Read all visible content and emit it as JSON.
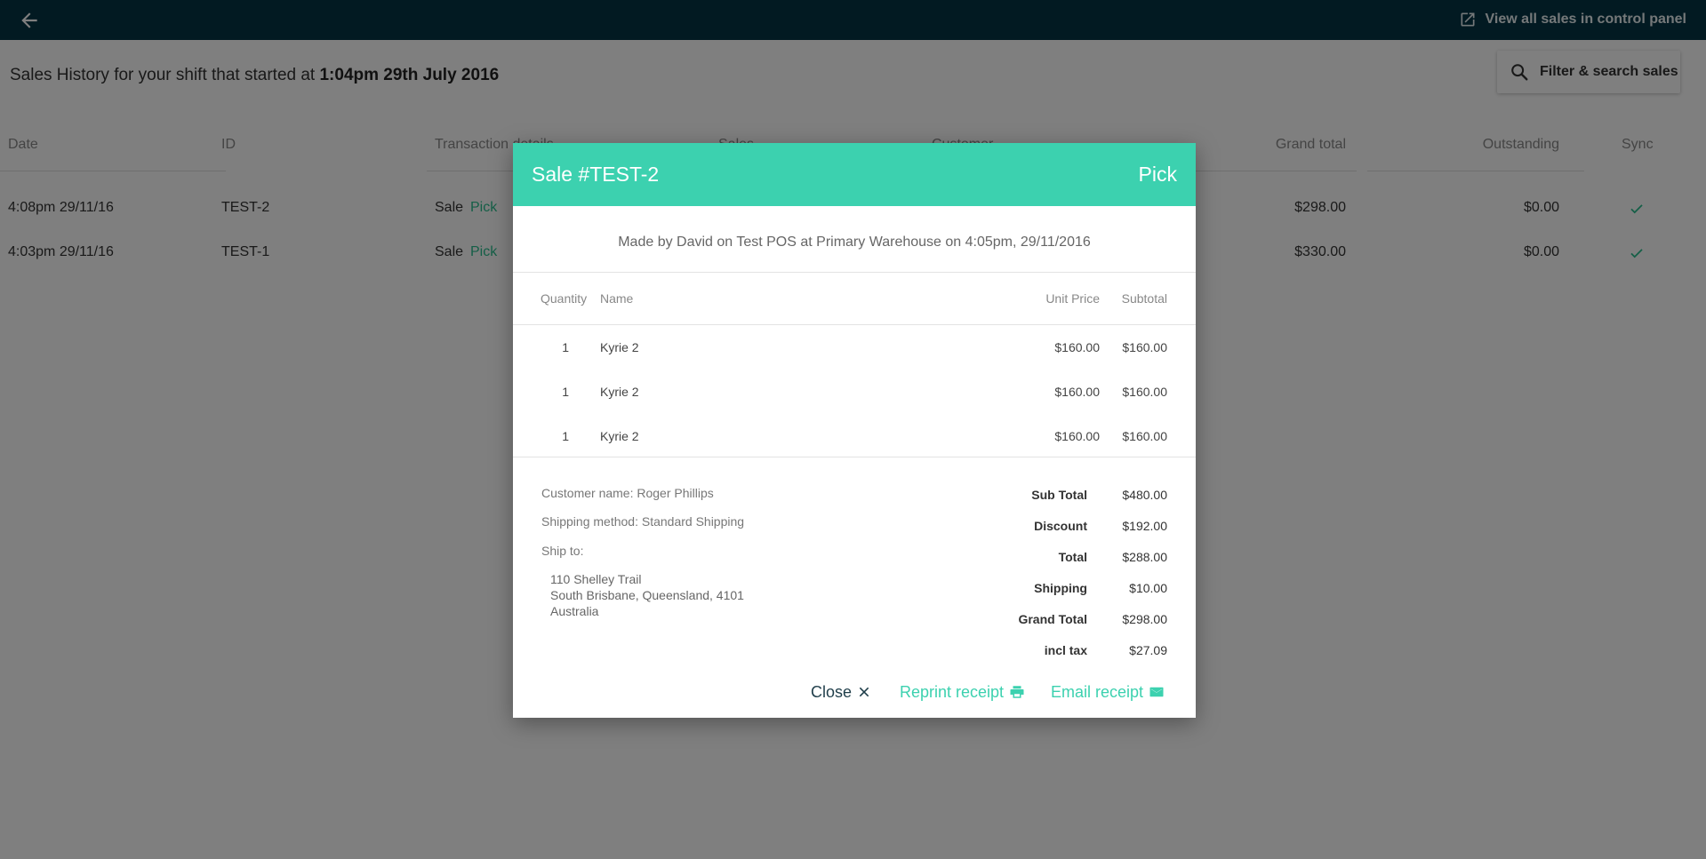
{
  "topbar": {
    "back_icon": "arrow-left-icon",
    "view_all_label": "View all sales in control panel",
    "view_all_icon": "external-link-icon"
  },
  "page": {
    "title_prefix": "Sales History for your shift that started at",
    "title_time": "1:04pm 29th July 2016",
    "filter_label": "Filter & search sales",
    "filter_icon": "search-icon"
  },
  "table": {
    "headers": {
      "date": "Date",
      "id": "ID",
      "transaction": "Transaction details",
      "sales": "Sales",
      "customer": "Customer",
      "grand_total": "Grand total",
      "outstanding": "Outstanding",
      "sync": "Sync"
    },
    "rows": [
      {
        "date": "4:08pm 29/11/16",
        "id": "TEST-2",
        "type": "Sale",
        "action": "Pick",
        "grand_total": "$298.00",
        "outstanding": "$0.00"
      },
      {
        "date": "4:03pm 29/11/16",
        "id": "TEST-1",
        "type": "Sale",
        "action": "Pick",
        "grand_total": "$330.00",
        "outstanding": "$0.00"
      }
    ],
    "sync_icon": "check-icon",
    "sync_color": "#2bbf8f"
  },
  "modal": {
    "title": "Sale #TEST-2",
    "pick_label": "Pick",
    "made_by": "Made by David on Test POS at Primary Warehouse on 4:05pm, 29/11/2016",
    "items_headers": {
      "quantity": "Quantity",
      "name": "Name",
      "unit_price": "Unit Price",
      "subtotal": "Subtotal"
    },
    "items": [
      {
        "quantity": "1",
        "name": "Kyrie 2",
        "unit_price": "$160.00",
        "subtotal": "$160.00"
      },
      {
        "quantity": "1",
        "name": "Kyrie 2",
        "unit_price": "$160.00",
        "subtotal": "$160.00"
      },
      {
        "quantity": "1",
        "name": "Kyrie 2",
        "unit_price": "$160.00",
        "subtotal": "$160.00"
      }
    ],
    "customer_name": "Customer name: Roger Phillips",
    "shipping_method": "Shipping method: Standard Shipping",
    "ship_to_label": "Ship to:",
    "address": [
      "110 Shelley Trail",
      "South Brisbane, Queensland, 4101",
      "Australia"
    ],
    "totals": [
      {
        "label": "Sub Total",
        "value": "$480.00"
      },
      {
        "label": "Discount",
        "value": "$192.00"
      },
      {
        "label": "Total",
        "value": "$288.00"
      },
      {
        "label": "Shipping",
        "value": "$10.00"
      },
      {
        "label": "Grand Total",
        "value": "$298.00"
      },
      {
        "label": "incl tax",
        "value": "$27.09"
      }
    ],
    "close_label": "Close",
    "close_icon": "close-icon",
    "reprint_label": "Reprint receipt",
    "reprint_icon": "printer-icon",
    "email_label": "Email receipt",
    "email_icon": "envelope-icon",
    "header_color": "#3cd1af"
  },
  "colors": {
    "topbar": "#053445",
    "accent": "#3cd1af",
    "pick_link": "#2bbf8f"
  }
}
